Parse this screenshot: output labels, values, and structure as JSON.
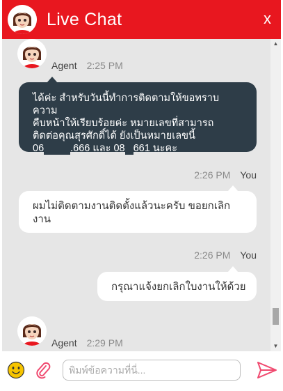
{
  "header": {
    "title": "Live Chat",
    "close_label": "x"
  },
  "messages": [
    {
      "sender": "Agent",
      "time": "2:25 PM",
      "lines": [
        "ได้ค่ะ สำหรับวันนี้ทำการติดตามให้ขอทราบความ",
        "คืบหน้าให้เรียบร้อยค่ะ หมายเลขที่สามารถ",
        "ติดต่อคุณสุรศักดิ์ได้ ยังเป็นหมายเลขนี้"
      ],
      "last_line": {
        "a": "06",
        "b": ".666 และ 08",
        "c": "661 นะคะ"
      }
    },
    {
      "sender": "You",
      "time": "2:26 PM",
      "text": "ผมไม่ติดตามงานติดตั้งแล้วนะครับ ขอยกเลิกงาน"
    },
    {
      "sender": "You",
      "time": "2:26 PM",
      "text": "กรุณาแจ้งยกเลิกใบงานให้ด้วย"
    },
    {
      "sender": "Agent",
      "time": "2:29 PM"
    }
  ],
  "input": {
    "placeholder": "พิมพ์ข้อความที่นี่..."
  },
  "icons": {
    "emoji": "emoji-icon",
    "attach": "paperclip-icon",
    "send": "send-icon",
    "avatar": "agent-avatar-icon"
  },
  "colors": {
    "brand_red": "#e8171f",
    "agent_bubble": "#2e3d48",
    "conversation_bg": "#e6e6e6",
    "send_pink": "#f0496f"
  }
}
